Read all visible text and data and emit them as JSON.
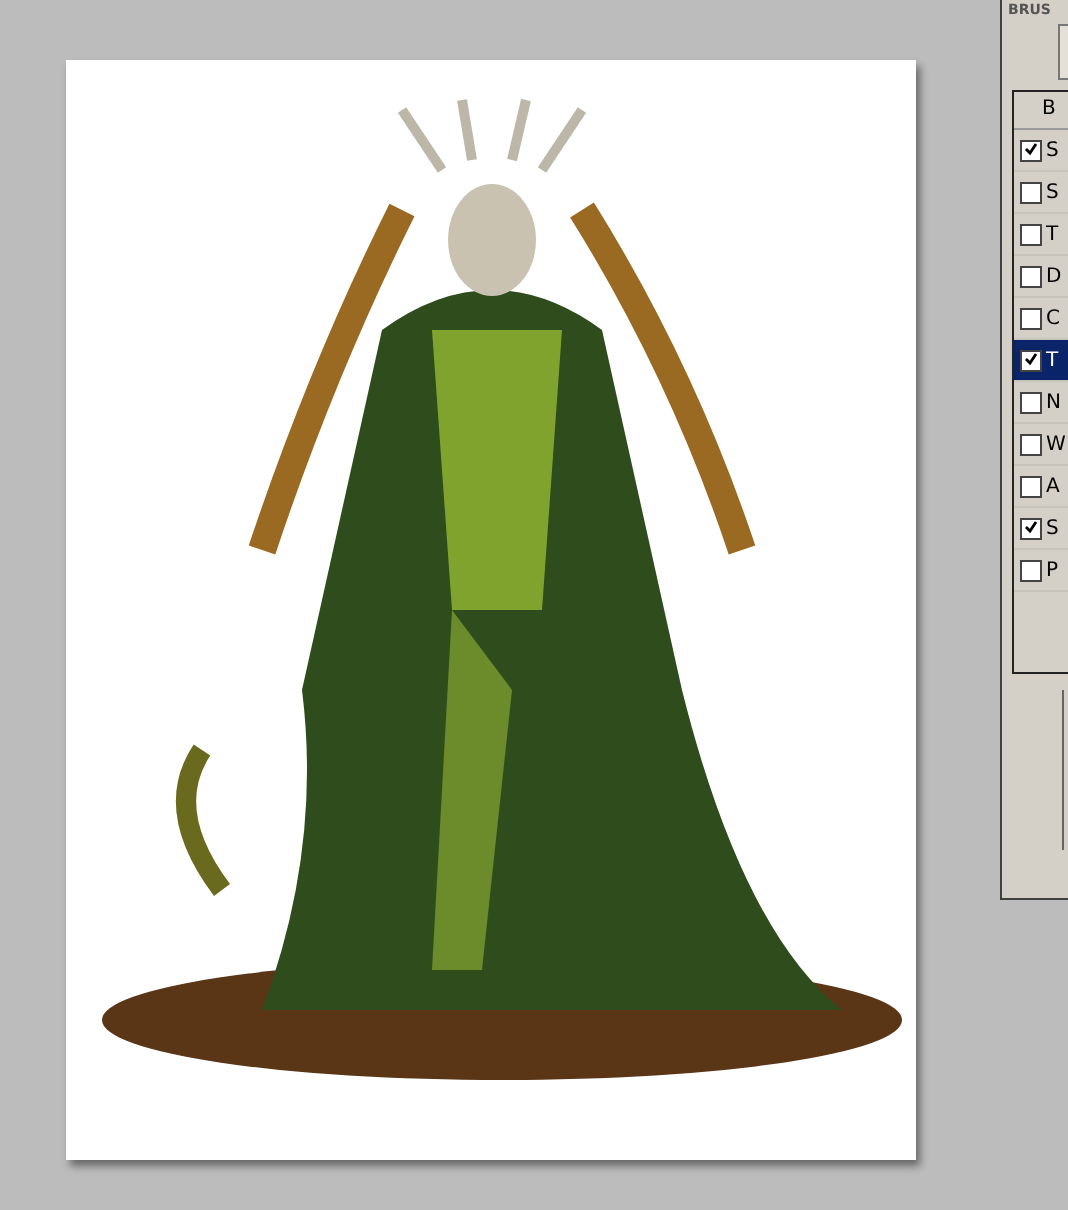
{
  "panel": {
    "title": "BRUS",
    "list_header": "B",
    "items": [
      {
        "label": "S",
        "checked": true,
        "selected": false
      },
      {
        "label": "S",
        "checked": false,
        "selected": false
      },
      {
        "label": "T",
        "checked": false,
        "selected": false
      },
      {
        "label": "D",
        "checked": false,
        "selected": false
      },
      {
        "label": "C",
        "checked": false,
        "selected": false
      },
      {
        "label": "T",
        "checked": true,
        "selected": true
      },
      {
        "label": "N",
        "checked": false,
        "selected": false
      },
      {
        "label": "W",
        "checked": false,
        "selected": false
      },
      {
        "label": "A",
        "checked": false,
        "selected": false
      },
      {
        "label": "S",
        "checked": true,
        "selected": false
      },
      {
        "label": "P",
        "checked": false,
        "selected": false
      }
    ]
  }
}
